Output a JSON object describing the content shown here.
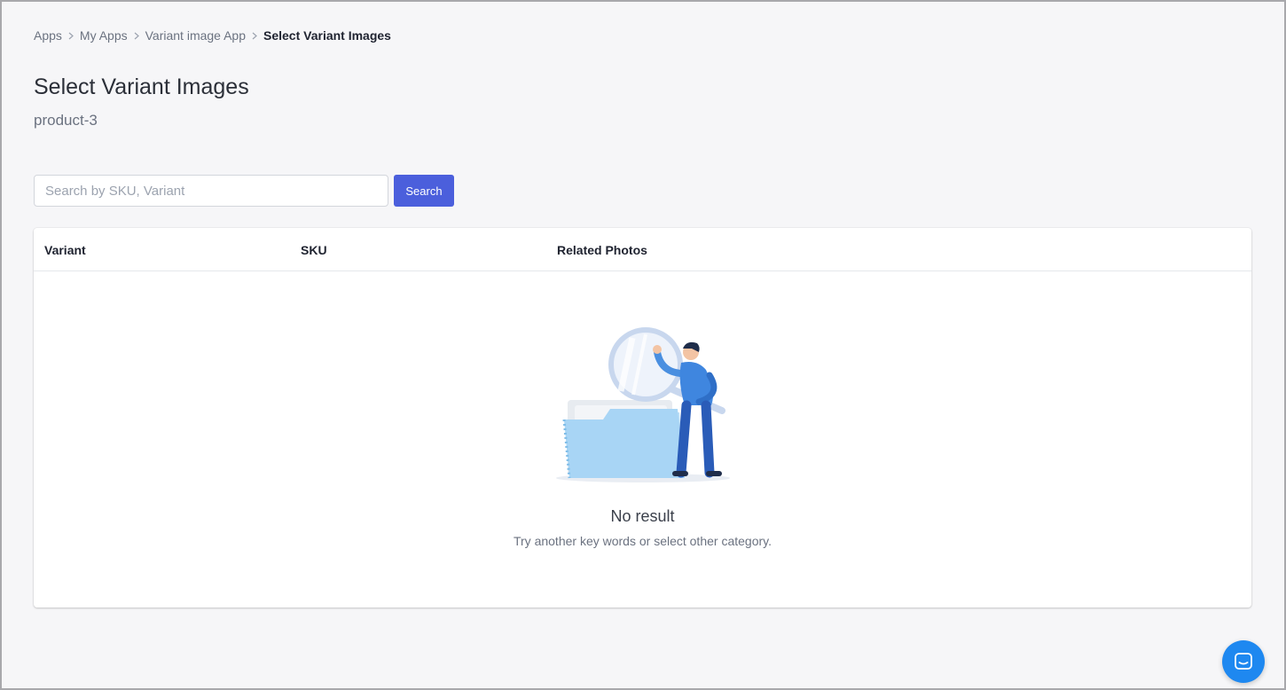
{
  "breadcrumb": {
    "items": [
      "Apps",
      "My Apps",
      "Variant image App"
    ],
    "current": "Select Variant Images"
  },
  "page": {
    "title": "Select Variant Images",
    "subtitle": "product-3"
  },
  "search": {
    "placeholder": "Search by SKU, Variant",
    "value": "",
    "button_label": "Search"
  },
  "table": {
    "columns": [
      "Variant",
      "SKU",
      "Related Photos"
    ]
  },
  "empty_state": {
    "title": "No result",
    "message": "Try another key words or select other category.",
    "illustration": "person-with-magnifier-and-folder"
  },
  "chat": {
    "icon": "chat-bubble-icon"
  },
  "colors": {
    "accent": "#4b5fdc",
    "chat": "#1e88f0",
    "background": "#f6f6f8"
  }
}
